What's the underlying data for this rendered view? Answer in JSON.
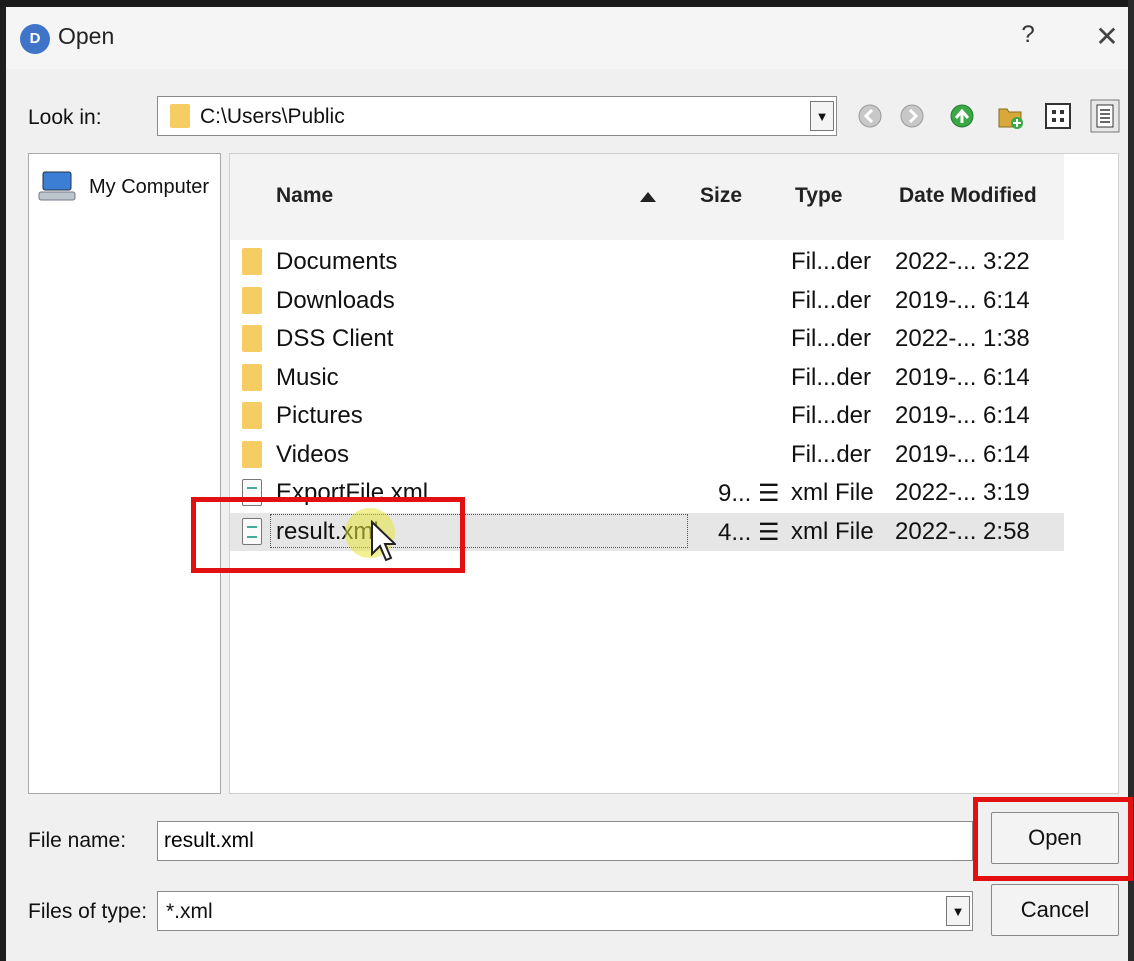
{
  "window": {
    "title": "Open",
    "app_icon_text": "D",
    "help_label": "?",
    "close_label": "✕"
  },
  "look_in": {
    "label": "Look in:",
    "value": "C:\\Users\\Public"
  },
  "toolbar": {
    "icons": [
      "back-icon",
      "forward-icon",
      "up-folder-icon",
      "new-folder-icon",
      "list-view-icon",
      "details-view-icon"
    ]
  },
  "places": {
    "items": [
      {
        "label": "My Computer",
        "icon": "computer-icon"
      }
    ]
  },
  "file_list": {
    "columns": {
      "name": "Name",
      "size": "Size",
      "type": "Type",
      "date": "Date Modified"
    },
    "sort_column": "Name",
    "sort_direction": "ascending",
    "rows": [
      {
        "name": "Documents",
        "size": "",
        "type": "Fil...der",
        "date": "2022-... 3:22",
        "icon": "folder-icon"
      },
      {
        "name": "Downloads",
        "size": "",
        "type": "Fil...der",
        "date": "2019-... 6:14",
        "icon": "folder-icon"
      },
      {
        "name": "DSS Client",
        "size": "",
        "type": "Fil...der",
        "date": "2022-... 1:38",
        "icon": "folder-icon"
      },
      {
        "name": "Music",
        "size": "",
        "type": "Fil...der",
        "date": "2019-... 6:14",
        "icon": "folder-icon"
      },
      {
        "name": "Pictures",
        "size": "",
        "type": "Fil...der",
        "date": "2019-... 6:14",
        "icon": "folder-icon"
      },
      {
        "name": "Videos",
        "size": "",
        "type": "Fil...der",
        "date": "2019-... 6:14",
        "icon": "folder-icon"
      },
      {
        "name": "ExportFile.xml",
        "size": "9... ☰",
        "type": "xml File",
        "date": "2022-... 3:19",
        "icon": "xml-file-icon"
      },
      {
        "name": "result.xml",
        "size": "4... ☰",
        "type": "xml File",
        "date": "2022-... 2:58",
        "icon": "xml-file-icon",
        "selected": true
      }
    ]
  },
  "file_name": {
    "label": "File name:",
    "value": "result.xml"
  },
  "file_type": {
    "label": "Files of type:",
    "value": "*.xml"
  },
  "buttons": {
    "open": "Open",
    "cancel": "Cancel"
  },
  "colors": {
    "highlight_box": "#e21010",
    "folder": "#f6cd62",
    "selection": "#e6e6e6"
  }
}
